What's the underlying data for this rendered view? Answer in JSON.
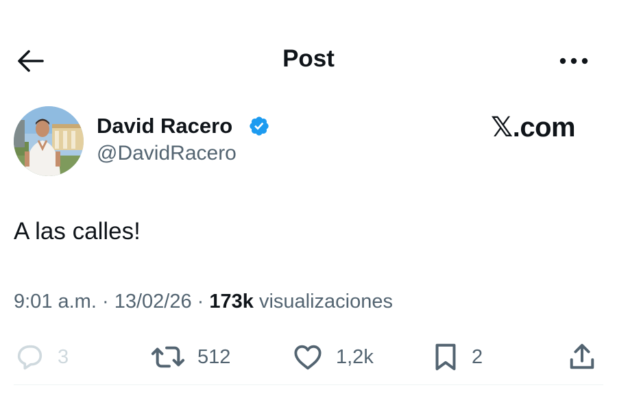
{
  "header": {
    "title": "Post",
    "back_icon": "arrow-left-icon",
    "more_icon": "more-horizontal-icon"
  },
  "author": {
    "name": "David Racero",
    "handle": "@DavidRacero",
    "verified_badge": "verified-badge-icon",
    "verified_color": "#1d9bf0"
  },
  "brand": {
    "label": "𝕏.com"
  },
  "post": {
    "text": "A las calles!"
  },
  "meta": {
    "time": "9:01 a.m.",
    "date": "13/02/26",
    "separator": "·",
    "views_count": "173k",
    "views_label": "visualizaciones"
  },
  "actions": {
    "reply": {
      "icon": "reply-icon",
      "count": "3"
    },
    "repost": {
      "icon": "repost-icon",
      "count": "512"
    },
    "like": {
      "icon": "heart-icon",
      "count": "1,2k"
    },
    "bookmark": {
      "icon": "bookmark-icon",
      "count": "2"
    },
    "share": {
      "icon": "share-icon"
    }
  },
  "colors": {
    "text_primary": "#0f1419",
    "text_secondary": "#536471",
    "disabled": "#cfd9de"
  }
}
